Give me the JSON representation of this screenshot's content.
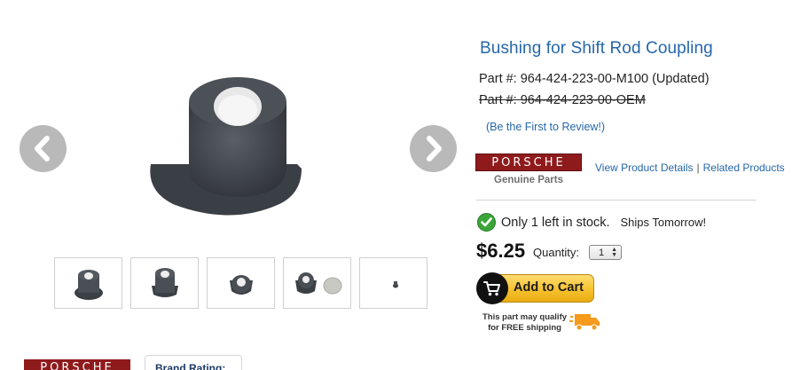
{
  "product": {
    "title": "Bushing for Shift Rod Coupling",
    "part_number": "Part #: 964-424-223-00-M100 (Updated)",
    "oem_number": "Part #: 964-424-223-00-OEM",
    "review_link": "(Be the First to Review!)"
  },
  "brand": {
    "name": "PORSCHE",
    "subtitle": "Genuine Parts"
  },
  "links": {
    "details": "View Product Details",
    "separator": "|",
    "related": "Related Products"
  },
  "stock": {
    "status": "Only 1 left in stock.",
    "shipping": "Ships Tomorrow!"
  },
  "purchase": {
    "price": "$6.25",
    "quantity_label": "Quantity:",
    "quantity_value": "1",
    "add_to_cart_label": "Add to Cart",
    "free_shipping_line1": "This part may qualify",
    "free_shipping_line2": "for FREE shipping"
  },
  "gallery": {
    "thumbnails": [
      "bushing-front",
      "bushing-angle",
      "bushing-top",
      "bushing-with-coin",
      "bushing-small"
    ]
  },
  "bottom": {
    "brand_rating_label": "Brand Rating:"
  },
  "colors": {
    "link": "#2667a9",
    "brand_red": "#8f1a1c",
    "cart_yellow": "#f6c22e",
    "check_green": "#3aa63a",
    "arrow_grey": "#b9b9b9"
  }
}
